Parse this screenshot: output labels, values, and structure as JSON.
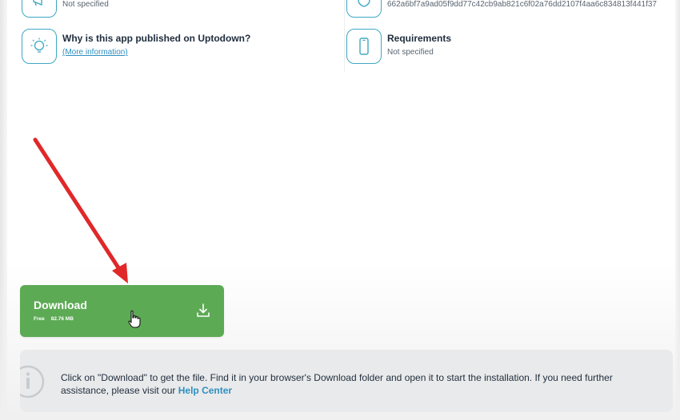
{
  "info": {
    "items": [
      {
        "title": "",
        "sub": "Not specified"
      },
      {
        "title": "",
        "sub": "662a6bf7a9ad05f9dd77c42cb9ab821c6f02a76dd2107f4aa6c834813f441f37"
      },
      {
        "title": "Why is this app published on Uptodown?",
        "link": "(More information)"
      },
      {
        "title": "Requirements",
        "sub": "Not specified"
      }
    ]
  },
  "download": {
    "label": "Download",
    "price": "Free",
    "size": "82.76 MB"
  },
  "notice": {
    "text": "Click on \"Download\" to get the file. Find it in your browser's Download folder and open it to start the installation. If you need further assistance, please visit our ",
    "link": "Help Center"
  },
  "colors": {
    "accent": "#3ea8c2",
    "download_green": "#5daa55",
    "link_blue": "#2f8fbf",
    "annotation_red": "#e0282a"
  }
}
